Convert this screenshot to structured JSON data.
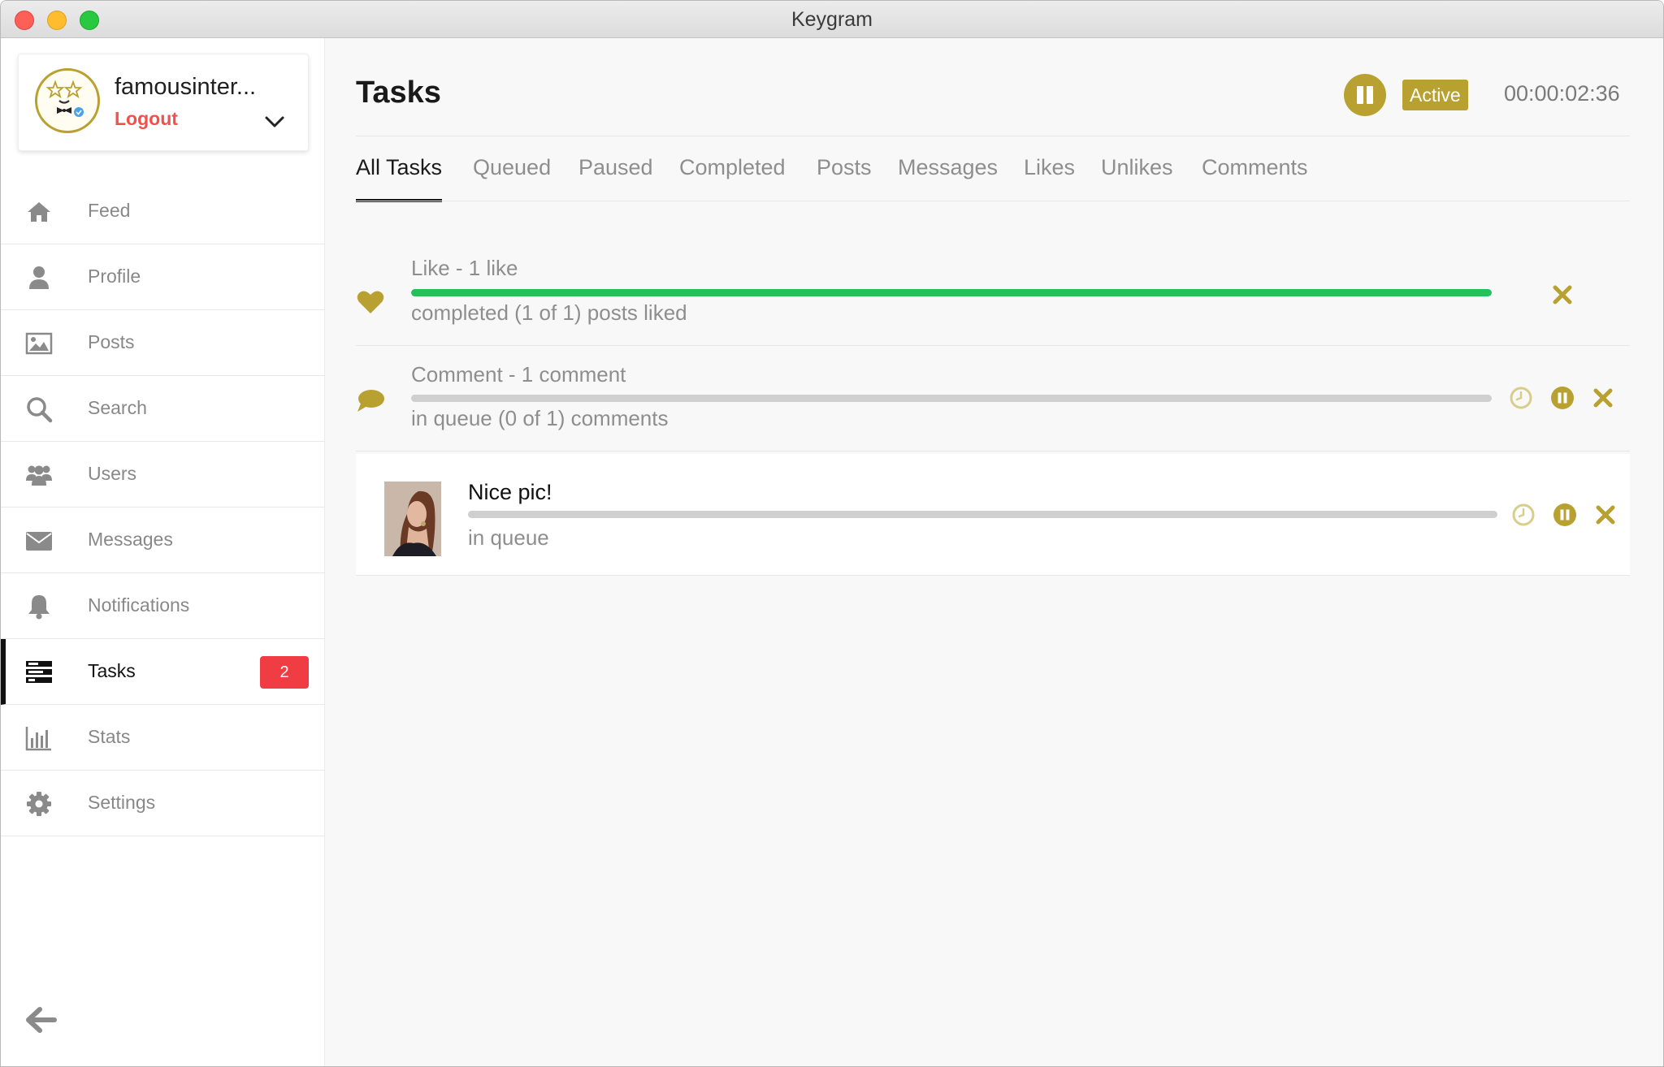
{
  "window": {
    "title": "Keygram"
  },
  "account": {
    "name": "famousinter...",
    "logout_label": "Logout"
  },
  "sidebar": {
    "items": [
      {
        "label": "Feed",
        "icon": "home-icon"
      },
      {
        "label": "Profile",
        "icon": "user-icon"
      },
      {
        "label": "Posts",
        "icon": "image-icon"
      },
      {
        "label": "Search",
        "icon": "search-icon"
      },
      {
        "label": "Users",
        "icon": "users-icon"
      },
      {
        "label": "Messages",
        "icon": "envelope-icon"
      },
      {
        "label": "Notifications",
        "icon": "bell-icon"
      },
      {
        "label": "Tasks",
        "icon": "tasks-icon",
        "badge": "2",
        "active": true
      },
      {
        "label": "Stats",
        "icon": "bar-chart-icon"
      },
      {
        "label": "Settings",
        "icon": "gear-icon"
      }
    ]
  },
  "header": {
    "title": "Tasks",
    "status": "Active",
    "timer": "00:00:02:36"
  },
  "tabs": [
    {
      "label": "All Tasks",
      "active": true
    },
    {
      "label": "Queued"
    },
    {
      "label": "Paused"
    },
    {
      "label": "Completed"
    },
    {
      "label": "Posts"
    },
    {
      "label": "Messages"
    },
    {
      "label": "Likes"
    },
    {
      "label": "Unlikes"
    },
    {
      "label": "Comments"
    }
  ],
  "tasks": [
    {
      "title": "Like - 1 like",
      "status": "completed (1 of 1) posts liked",
      "progress": 1.0,
      "icon": "heart-icon"
    },
    {
      "title": "Comment - 1 comment",
      "status": "in queue (0 of 1) comments",
      "progress": 0.0,
      "icon": "comment-icon"
    }
  ],
  "subtask": {
    "title": "Nice pic!",
    "status": "in queue",
    "progress": 0.0
  },
  "colors": {
    "accent": "#b8a131",
    "progress": "#23c05c",
    "badge": "#f03c43",
    "logout": "#f0514c"
  }
}
